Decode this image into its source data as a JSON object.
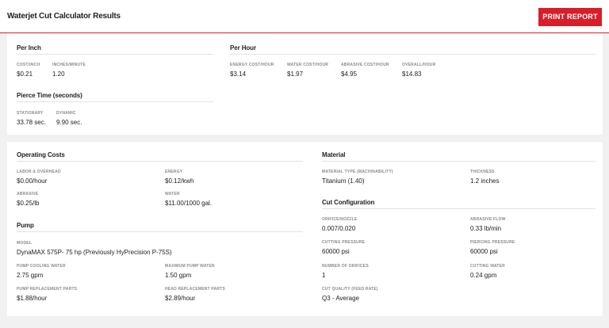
{
  "header": {
    "title": "Waterjet Cut Calculator Results",
    "print_label": "PRINT REPORT"
  },
  "per_inch": {
    "title": "Per Inch",
    "cost_label": "COST/INCH",
    "cost_value": "$0.21",
    "ipm_label": "INCHES/MINUTE",
    "ipm_value": "1.20"
  },
  "per_hour": {
    "title": "Per Hour",
    "energy_label": "ENERGY COST/HOUR",
    "energy_value": "$3.14",
    "water_label": "WATER COST/HOUR",
    "water_value": "$1.97",
    "abrasive_label": "ABRASIVE COST/HOUR",
    "abrasive_value": "$4.95",
    "overall_label": "OVERALL/HOUR",
    "overall_value": "$14.83"
  },
  "pierce_time": {
    "title": "Pierce Time (seconds)",
    "stationary_label": "STATIONARY",
    "stationary_value": "33.78 sec.",
    "dynamic_label": "DYNAMIC",
    "dynamic_value": "9.90 sec."
  },
  "operating_costs": {
    "title": "Operating Costs",
    "labor_label": "LABOR & OVERHEAD",
    "labor_value": "$0.00/hour",
    "energy_label": "ENERGY",
    "energy_value": "$0.12/kwh",
    "abrasive_label": "ABRASIVE",
    "abrasive_value": "$0.25/lb",
    "water_label": "WATER",
    "water_value": "$11.00/1000 gal."
  },
  "pump": {
    "title": "Pump",
    "model_label": "MODEL",
    "model_value": "DynaMAX 575P- 75 hp (Previously HyPrecision P-75S)",
    "cooling_label": "PUMP COOLING WATER",
    "cooling_value": "2.75 gpm",
    "max_water_label": "MAXIMUM PUMP WATER",
    "max_water_value": "1.50 gpm",
    "replacement_label": "PUMP REPLACEMENT PARTS",
    "replacement_value": "$1.88/hour",
    "head_label": "HEAD REPLACEMENT PARTS",
    "head_value": "$2.89/hour"
  },
  "material": {
    "title": "Material",
    "type_label": "MATERIAL TYPE (MACHINABILITY)",
    "type_value": "Titanium (1.40)",
    "thickness_label": "THICKNESS",
    "thickness_value": "1.2 inches"
  },
  "cut_config": {
    "title": "Cut Configuration",
    "orifice_label": "ORIFICE/NOZZLE",
    "orifice_value": "0.007/0.020",
    "abrasive_flow_label": "ABRASIVE FLOW",
    "abrasive_flow_value": "0.33 lb/min",
    "cutting_pressure_label": "CUTTING PRESSURE",
    "cutting_pressure_value": "60000 psi",
    "piercing_pressure_label": "PIERCING PRESSURE",
    "piercing_pressure_value": "60000 psi",
    "orifices_label": "NUMBER OF ORIFICES",
    "orifices_value": "1",
    "cutting_water_label": "CUTTING WATER",
    "cutting_water_value": "0.24 gpm",
    "quality_label": "CUT QUALITY (FEED RATE)",
    "quality_value": "Q3 - Average"
  },
  "colors": {
    "accent": "#d91e2a",
    "background": "#f1f1f1",
    "card": "#ffffff"
  }
}
